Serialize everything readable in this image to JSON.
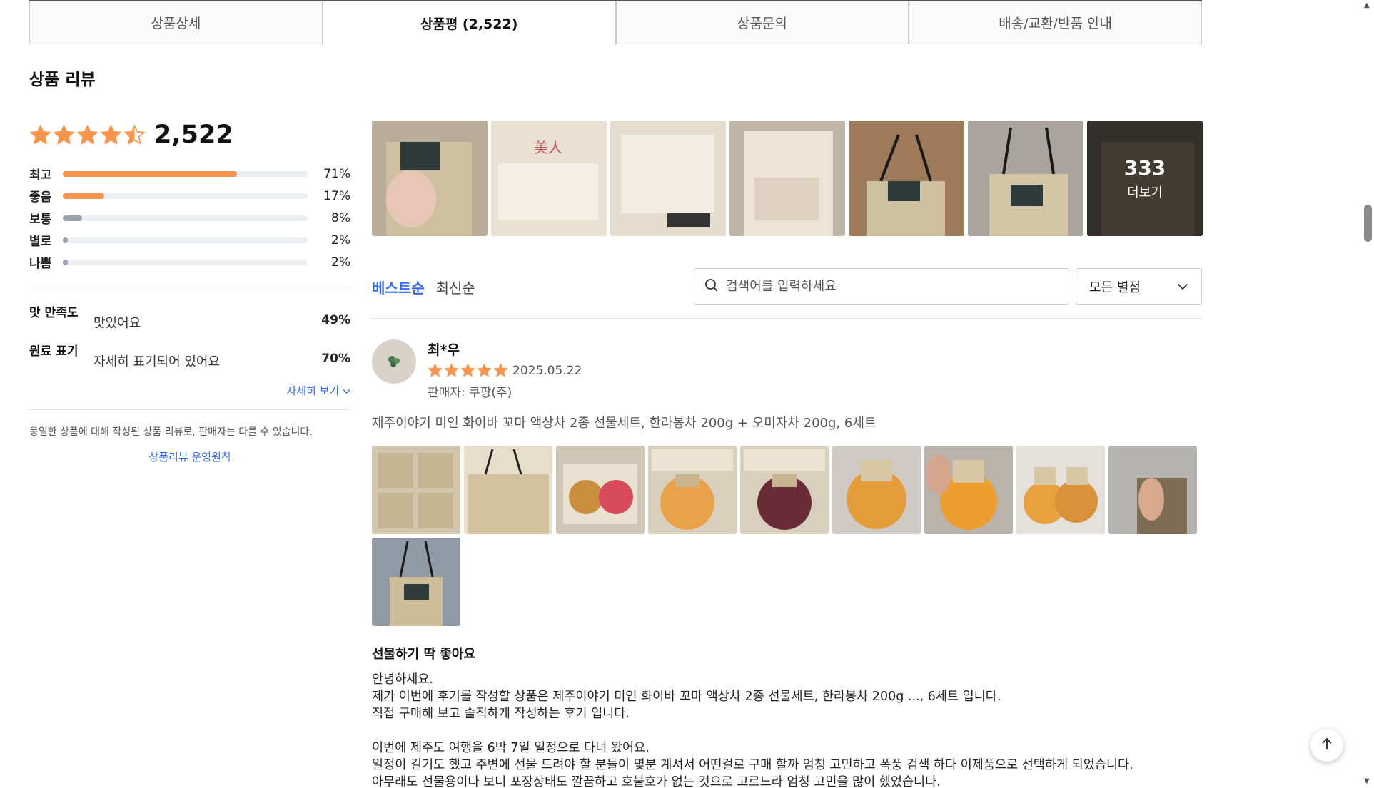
{
  "tabs": [
    {
      "label": "상품상세"
    },
    {
      "label": "상품평 (2,522)"
    },
    {
      "label": "상품문의"
    },
    {
      "label": "배송/교환/반품 안내"
    }
  ],
  "section_title": "상품 리뷰",
  "summary": {
    "rating": 4.5,
    "total_count": "2,522",
    "distribution": [
      {
        "label": "최고",
        "pct": "71%",
        "value": 71,
        "color": "#f7954d"
      },
      {
        "label": "좋음",
        "pct": "17%",
        "value": 17,
        "color": "#f7954d"
      },
      {
        "label": "보통",
        "pct": "8%",
        "value": 8,
        "color": "#9aa3ad"
      },
      {
        "label": "별로",
        "pct": "2%",
        "value": 2,
        "color": "#9aa3ad"
      },
      {
        "label": "나쁨",
        "pct": "2%",
        "value": 2,
        "color": "#9aa3ad"
      }
    ],
    "attributes": [
      {
        "name": "맛 만족도",
        "value": "맛있어요",
        "pct": "49%"
      },
      {
        "name": "원료 표기",
        "value": "자세히 표기되어 있어요",
        "pct": "70%"
      }
    ],
    "more_link": "자세히 보기",
    "notice": "동일한 상품에 대해 작성된 상품 리뷰로, 판매자는 다를 수 있습니다.",
    "policy_link": "상품리뷰 운영원칙"
  },
  "photo_strip": {
    "more_count": "333",
    "more_label": "더보기"
  },
  "sort": {
    "best": "베스트순",
    "latest": "최신순"
  },
  "search": {
    "placeholder": "검색어를 입력하세요"
  },
  "filter": {
    "selected": "모든 별점"
  },
  "review": {
    "name": "최*우",
    "rating": 5,
    "date": "2025.05.22",
    "seller": "판매자: 쿠팡(주)",
    "product": "제주이야기 미인 화이바 꼬마 액상차 2종 선물세트, 한라봉차 200g + 오미자차 200g, 6세트",
    "headline": "선물하기 딱 좋아요",
    "body": [
      "안녕하세요.",
      "제가 이번에 후기를 작성할 상품은 제주이야기 미인 화이바 꼬마 액상차 2종 선물세트, 한라봉차 200g ..., 6세트 입니다.",
      "직접 구매해 보고 솔직하게 작성하는 후기 입니다.",
      "",
      "이번에 제주도 여행을 6박 7일 일정으로 다녀 왔어요.",
      "일정이 길기도 했고 주변에 선물 드려야 할 분들이 몇분 계셔서 어떤걸로 구매 할까 엄청 고민하고 폭풍 검색 하다 이제품으로 선택하게 되었습니다.",
      "아무래도 선물용이다 보니 포장상태도 깔끔하고 호불호가 없는 것으로 고르느라 엄청 고민을 많이 했었습니다."
    ]
  },
  "colors": {
    "accent": "#346aff",
    "star": "#f7954d"
  }
}
